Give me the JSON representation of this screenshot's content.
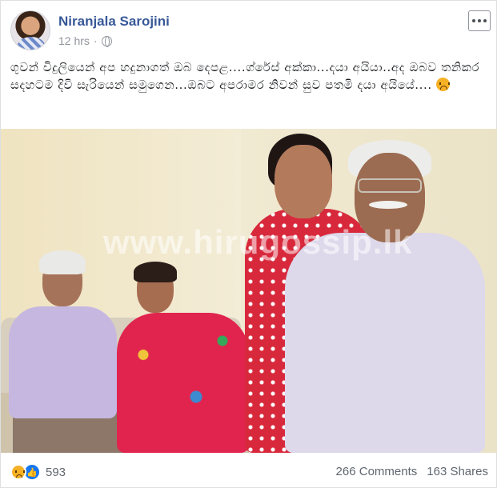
{
  "post": {
    "author": "Niranjala Sarojini",
    "timestamp": "12 hrs",
    "separator": "·",
    "privacy_icon": "globe-icon",
    "more_icon": "more-options-icon",
    "text": "ගුවන් විදුලියෙන් අප හදුනාගත් ඔබ දෙපළ....ග්රේස් අක්කා...දයා අයියා..අද ඔබව තනිකර සදහටම දිවි සැරියෙන් සමුගෙන...ඔබට අපරාමර නිවන් සුව පතමි දයා අයියේ....",
    "text_emoji": "sad-face-emoji"
  },
  "photo": {
    "watermark": "www.hirugossip.lk"
  },
  "footer": {
    "reaction_icons": [
      "sad-reaction-icon",
      "like-reaction-icon"
    ],
    "reaction_count": "593",
    "comments": "266 Comments",
    "shares": "163 Shares"
  },
  "colors": {
    "author_link": "#385898",
    "meta_gray": "#90949c",
    "like_blue": "#1877f2",
    "sad_yellow": "#f7b125"
  }
}
